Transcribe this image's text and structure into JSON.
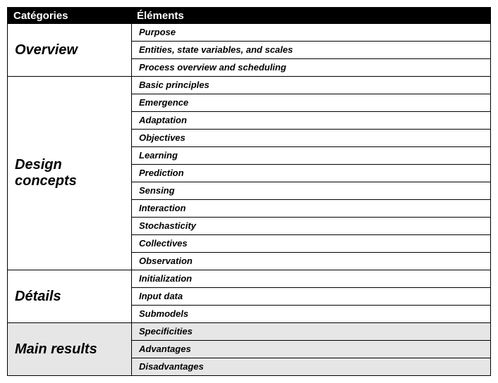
{
  "headers": {
    "categories": "Catégories",
    "elements": "Éléments"
  },
  "groups": [
    {
      "category": "Overview",
      "shaded": false,
      "items": [
        "Purpose",
        "Entities, state variables, and scales",
        "Process overview and scheduling"
      ]
    },
    {
      "category": "Design concepts",
      "shaded": false,
      "items": [
        "Basic principles",
        "Emergence",
        "Adaptation",
        "Objectives",
        "Learning",
        "Prediction",
        "Sensing",
        "Interaction",
        "Stochasticity",
        "Collectives",
        "Observation"
      ]
    },
    {
      "category": "Détails",
      "shaded": false,
      "items": [
        "Initialization",
        "Input data",
        "Submodels"
      ]
    },
    {
      "category": "Main results",
      "shaded": true,
      "items": [
        "Specificities",
        "Advantages",
        "Disadvantages"
      ]
    }
  ]
}
